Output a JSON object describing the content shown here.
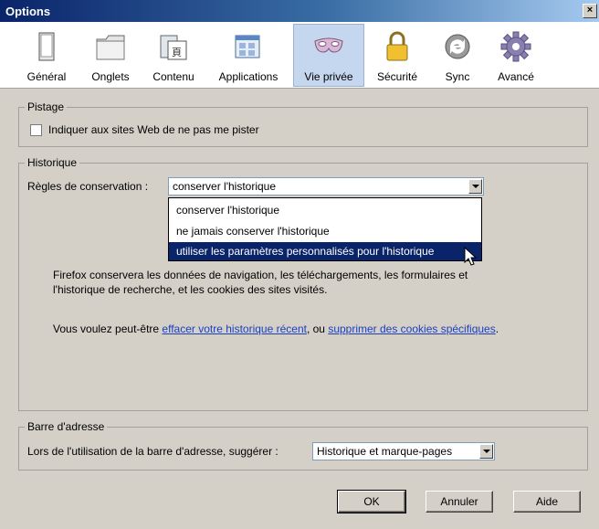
{
  "window": {
    "title": "Options",
    "close_glyph": "×"
  },
  "tabs": [
    {
      "label": "Général",
      "icon": "window-icon"
    },
    {
      "label": "Onglets",
      "icon": "tabs-folder-icon"
    },
    {
      "label": "Contenu",
      "icon": "content-page-icon"
    },
    {
      "label": "Applications",
      "icon": "applications-icon"
    },
    {
      "label": "Vie privée",
      "icon": "privacy-mask-icon"
    },
    {
      "label": "Sécurité",
      "icon": "padlock-icon"
    },
    {
      "label": "Sync",
      "icon": "sync-icon"
    },
    {
      "label": "Avancé",
      "icon": "gear-icon"
    }
  ],
  "active_tab": "Vie privée",
  "tracking": {
    "title": "Pistage",
    "checkbox_label": "Indiquer aux sites Web de ne pas me pister",
    "checked": false
  },
  "history": {
    "title": "Historique",
    "rules_label": "Règles de conservation :",
    "selected": "conserver l'historique",
    "options": [
      "conserver l'historique",
      "ne jamais conserver l'historique",
      "utiliser les paramètres personnalisés pour l'historique"
    ],
    "highlighted_option": "utiliser les paramètres personnalisés pour l'historique",
    "description_line1": "Firefox conservera les données de navigation, les téléchargements, les formulaires et",
    "description_line2": "l'historique de recherche, et les cookies des sites visités.",
    "suggest_prefix": "Vous voulez peut-être ",
    "link_clear_history": "effacer votre historique récent",
    "suggest_middle": ", ou ",
    "link_remove_cookies": "supprimer des cookies spécifiques",
    "suggest_suffix": "."
  },
  "address_bar": {
    "title": "Barre d'adresse",
    "suggest_label": "Lors de l'utilisation de la barre d'adresse, suggérer :",
    "selected": "Historique et marque-pages"
  },
  "buttons": {
    "ok": "OK",
    "cancel": "Annuler",
    "help": "Aide"
  },
  "colors": {
    "accent": "#0a246a",
    "link": "#1a3fbf",
    "active_tab": "#c4d7ee",
    "dialog_bg": "#d4d0c8"
  }
}
